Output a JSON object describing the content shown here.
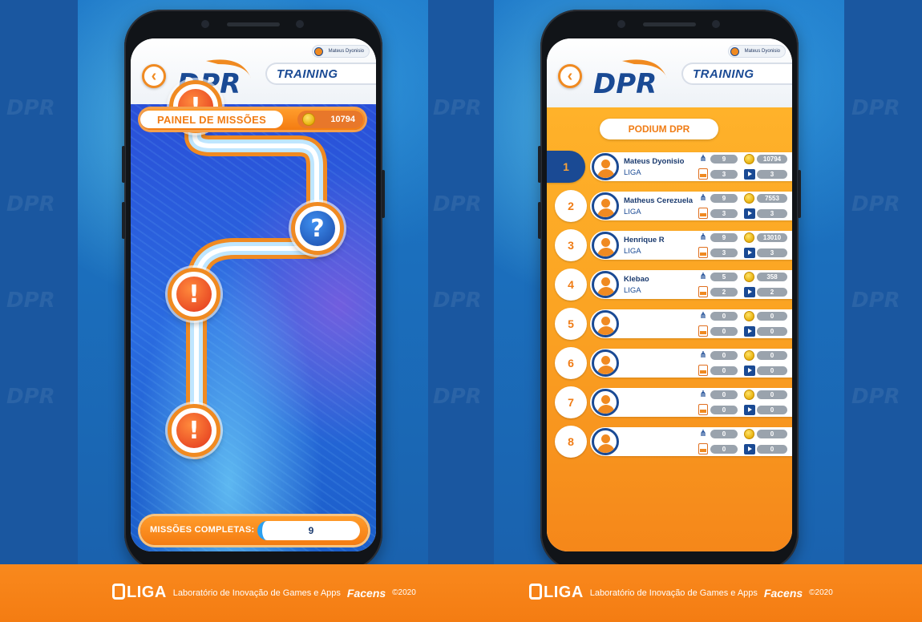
{
  "left_phone": {
    "user_name": "Mateus Dyonisio",
    "brand": "DPR",
    "mode": "TRAINING",
    "panel_title": "PAINEL DE MISSÕES",
    "coins": "10794",
    "missions_label": "MISSÕES COMPLETAS:",
    "missions_value": "9",
    "nodes": [
      "!",
      "?",
      "!",
      "!"
    ]
  },
  "right_phone": {
    "user_name": "Mateus Dyonisio",
    "brand": "DPR",
    "mode": "TRAINING",
    "podium_title": "PODIUM DPR",
    "players": [
      {
        "rank": "1",
        "name": "Mateus Dyonisio",
        "team": "LIGA",
        "links": "9",
        "coins": "10794",
        "pdf": "3",
        "video": "3"
      },
      {
        "rank": "2",
        "name": "Matheus Cerezuela",
        "team": "LIGA",
        "links": "9",
        "coins": "7553",
        "pdf": "3",
        "video": "3"
      },
      {
        "rank": "3",
        "name": "Henrique R",
        "team": "LIGA",
        "links": "9",
        "coins": "13010",
        "pdf": "3",
        "video": "3"
      },
      {
        "rank": "4",
        "name": "Klebao",
        "team": "LIGA",
        "links": "5",
        "coins": "358",
        "pdf": "2",
        "video": "2"
      },
      {
        "rank": "5",
        "name": "",
        "team": "",
        "links": "0",
        "coins": "0",
        "pdf": "0",
        "video": "0"
      },
      {
        "rank": "6",
        "name": "",
        "team": "",
        "links": "0",
        "coins": "0",
        "pdf": "0",
        "video": "0"
      },
      {
        "rank": "7",
        "name": "",
        "team": "",
        "links": "0",
        "coins": "0",
        "pdf": "0",
        "video": "0"
      },
      {
        "rank": "8",
        "name": "",
        "team": "",
        "links": "0",
        "coins": "0",
        "pdf": "0",
        "video": "0"
      }
    ]
  },
  "footer": {
    "logo": "LIGA",
    "description": "Laboratório de Inovação de Games e Apps",
    "partner": "Facens",
    "year": "©2020"
  },
  "colors": {
    "brand_blue": "#1a4a94",
    "brand_orange": "#f08a21"
  }
}
